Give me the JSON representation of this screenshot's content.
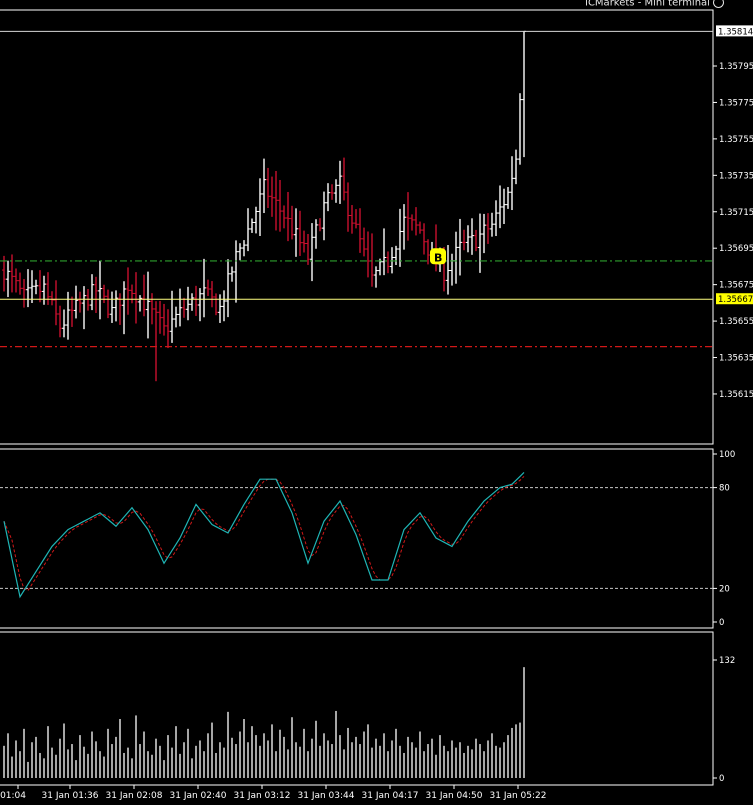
{
  "window": {
    "brand": "ICMarkets - Mini terminal"
  },
  "colors": {
    "background": "#000000",
    "frame": "#ffffff",
    "bar": "#c8102e",
    "bar_up": "#ffffff",
    "current_price_line": "#ffff80",
    "badge_yellow": "#ffff00",
    "green_level": "#2e9e2e",
    "red_level": "#d01818",
    "stoch_main": "#1fb5b5",
    "stoch_signal": "#d01818",
    "level_dots": "#c8c8c8",
    "volume": "#ffffff"
  },
  "chart_data": [
    {
      "type": "bar",
      "role": "price",
      "ylim": [
        1.356,
        1.3583
      ],
      "yticks": [
        "1.35795",
        "1.35775",
        "1.35755",
        "1.35735",
        "1.35715",
        "1.35695",
        "1.35675",
        "1.35655",
        "1.35635",
        "1.35615"
      ],
      "ytick_values": [
        1.35795,
        1.35775,
        1.35755,
        1.35735,
        1.35715,
        1.35695,
        1.35675,
        1.35655,
        1.35635,
        1.35615
      ],
      "levels": [
        {
          "label": "1.35814",
          "value": 1.35814,
          "style": "solid",
          "color": "white"
        },
        {
          "label": "1.35667",
          "value": 1.35667,
          "style": "solid",
          "color": "yellow"
        },
        {
          "value": 1.35688,
          "style": "dash-dot",
          "color": "green"
        },
        {
          "value": 1.35641,
          "style": "dash-dot",
          "color": "red"
        }
      ],
      "markers": [
        {
          "label": "B",
          "index": 108,
          "price": 1.3569
        }
      ],
      "anchors": [
        [
          0,
          1.35683
        ],
        [
          5,
          1.35668
        ],
        [
          10,
          1.35673
        ],
        [
          14,
          1.35652
        ],
        [
          18,
          1.35662
        ],
        [
          23,
          1.35672
        ],
        [
          27,
          1.3566
        ],
        [
          31,
          1.35675
        ],
        [
          35,
          1.35665
        ],
        [
          40,
          1.3565
        ],
        [
          45,
          1.35662
        ],
        [
          50,
          1.3567
        ],
        [
          54,
          1.35662
        ],
        [
          58,
          1.3569
        ],
        [
          62,
          1.3571
        ],
        [
          65,
          1.35728
        ],
        [
          70,
          1.35713
        ],
        [
          76,
          1.3569
        ],
        [
          80,
          1.35718
        ],
        [
          84,
          1.3573
        ],
        [
          88,
          1.35705
        ],
        [
          92,
          1.35678
        ],
        [
          96,
          1.35688
        ],
        [
          100,
          1.3571
        ],
        [
          104,
          1.35705
        ],
        [
          107,
          1.3569
        ],
        [
          110,
          1.35682
        ],
        [
          114,
          1.35695
        ],
        [
          118,
          1.357
        ],
        [
          122,
          1.35708
        ],
        [
          126,
          1.35725
        ],
        [
          128,
          1.35745
        ],
        [
          129,
          1.3578
        ],
        [
          130,
          1.35808
        ]
      ],
      "bar_count": 131,
      "last": 1.35814
    },
    {
      "type": "line",
      "role": "stochastic",
      "ylim": [
        0,
        100
      ],
      "yticks": [
        "100",
        "80",
        "20",
        "0"
      ],
      "ytick_values": [
        100,
        80,
        20,
        0
      ],
      "levels": [
        80,
        20
      ],
      "anchors": [
        [
          0,
          60
        ],
        [
          4,
          15
        ],
        [
          8,
          30
        ],
        [
          12,
          45
        ],
        [
          16,
          55
        ],
        [
          20,
          60
        ],
        [
          24,
          65
        ],
        [
          28,
          57
        ],
        [
          32,
          68
        ],
        [
          36,
          55
        ],
        [
          40,
          35
        ],
        [
          44,
          50
        ],
        [
          48,
          70
        ],
        [
          52,
          58
        ],
        [
          56,
          53
        ],
        [
          60,
          70
        ],
        [
          64,
          85
        ],
        [
          68,
          85
        ],
        [
          72,
          65
        ],
        [
          76,
          35
        ],
        [
          80,
          60
        ],
        [
          84,
          72
        ],
        [
          88,
          52
        ],
        [
          92,
          25
        ],
        [
          96,
          25
        ],
        [
          100,
          55
        ],
        [
          104,
          65
        ],
        [
          108,
          50
        ],
        [
          112,
          45
        ],
        [
          116,
          60
        ],
        [
          120,
          72
        ],
        [
          124,
          80
        ],
        [
          127,
          82
        ],
        [
          130,
          89
        ]
      ],
      "series": [
        {
          "role": "main"
        },
        {
          "role": "signal"
        }
      ]
    },
    {
      "type": "bar",
      "role": "volume",
      "ylim": [
        0,
        132
      ],
      "yticks": [
        "132",
        "0"
      ],
      "ytick_values": [
        132,
        0
      ],
      "base_values": [
        36,
        50,
        24,
        42,
        30,
        55,
        18,
        40,
        46,
        28,
        22,
        58,
        34,
        26,
        44,
        61,
        32,
        38,
        20,
        48,
        35,
        27,
        52,
        41,
        30,
        24,
        55,
        38,
        46,
        66,
        28,
        34,
        22,
        70,
        38,
        52,
        30,
        26,
        44,
        36,
        20,
        48,
        34,
        58,
        27,
        40,
        55,
        22,
        36,
        42,
        30,
        50,
        62,
        28,
        40,
        34,
        74,
        45,
        38,
        52,
        66,
        40,
        58,
        48,
        36,
        50,
        42,
        60,
        30,
        54,
        46,
        32,
        68,
        40,
        35,
        55,
        30,
        44,
        64,
        36,
        50,
        42,
        38,
        75,
        48,
        32,
        56,
        40,
        46,
        38,
        52,
        60,
        34,
        44,
        36,
        50,
        30,
        42,
        55,
        36,
        28,
        46,
        40,
        34,
        52,
        30,
        38,
        44,
        26,
        48,
        36,
        30,
        42,
        34,
        40,
        28,
        36,
        32,
        44,
        38,
        30,
        42,
        50,
        36,
        34,
        40,
        48,
        56,
        60,
        62,
        124
      ],
      "xticks": [
        "01:04",
        "31 Jan 01:36",
        "31 Jan 02:08",
        "31 Jan 02:40",
        "31 Jan 03:12",
        "31 Jan 03:44",
        "31 Jan 04:17",
        "31 Jan 04:50",
        "31 Jan 05:22"
      ]
    }
  ]
}
